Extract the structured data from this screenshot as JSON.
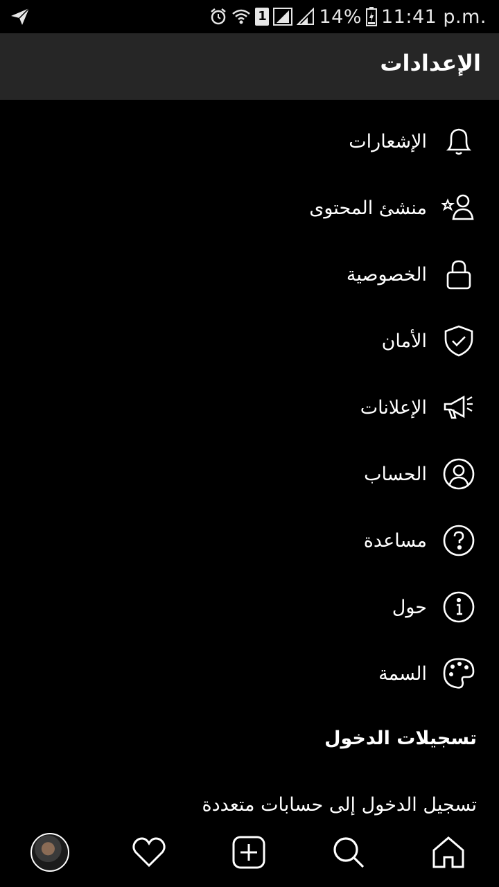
{
  "status_bar": {
    "battery_percent": "14%",
    "time": "11:41 p.m.",
    "sim_badge": "1",
    "icons": [
      "telegram-send-icon",
      "alarm-icon",
      "wifi-icon",
      "sim-1-icon",
      "signal-icon",
      "signal-icon",
      "battery-charging-icon"
    ]
  },
  "header": {
    "title": "الإعدادات"
  },
  "menu": {
    "items": [
      {
        "label": "الإشعارات",
        "icon": "bell-icon"
      },
      {
        "label": "منشئ المحتوى",
        "icon": "creator-user-star-icon"
      },
      {
        "label": "الخصوصية",
        "icon": "lock-icon"
      },
      {
        "label": "الأمان",
        "icon": "shield-check-icon"
      },
      {
        "label": "الإعلانات",
        "icon": "megaphone-icon"
      },
      {
        "label": "الحساب",
        "icon": "account-circle-icon"
      },
      {
        "label": "مساعدة",
        "icon": "help-icon"
      },
      {
        "label": "حول",
        "icon": "info-icon"
      },
      {
        "label": "السمة",
        "icon": "palette-icon"
      }
    ]
  },
  "logins": {
    "section_title": "تسجيلات الدخول",
    "multi_account": "تسجيل الدخول إلى حسابات متعددة"
  },
  "bottom_nav": {
    "items": [
      "profile-avatar",
      "heart-icon",
      "add-post-icon",
      "search-icon",
      "home-icon"
    ]
  }
}
